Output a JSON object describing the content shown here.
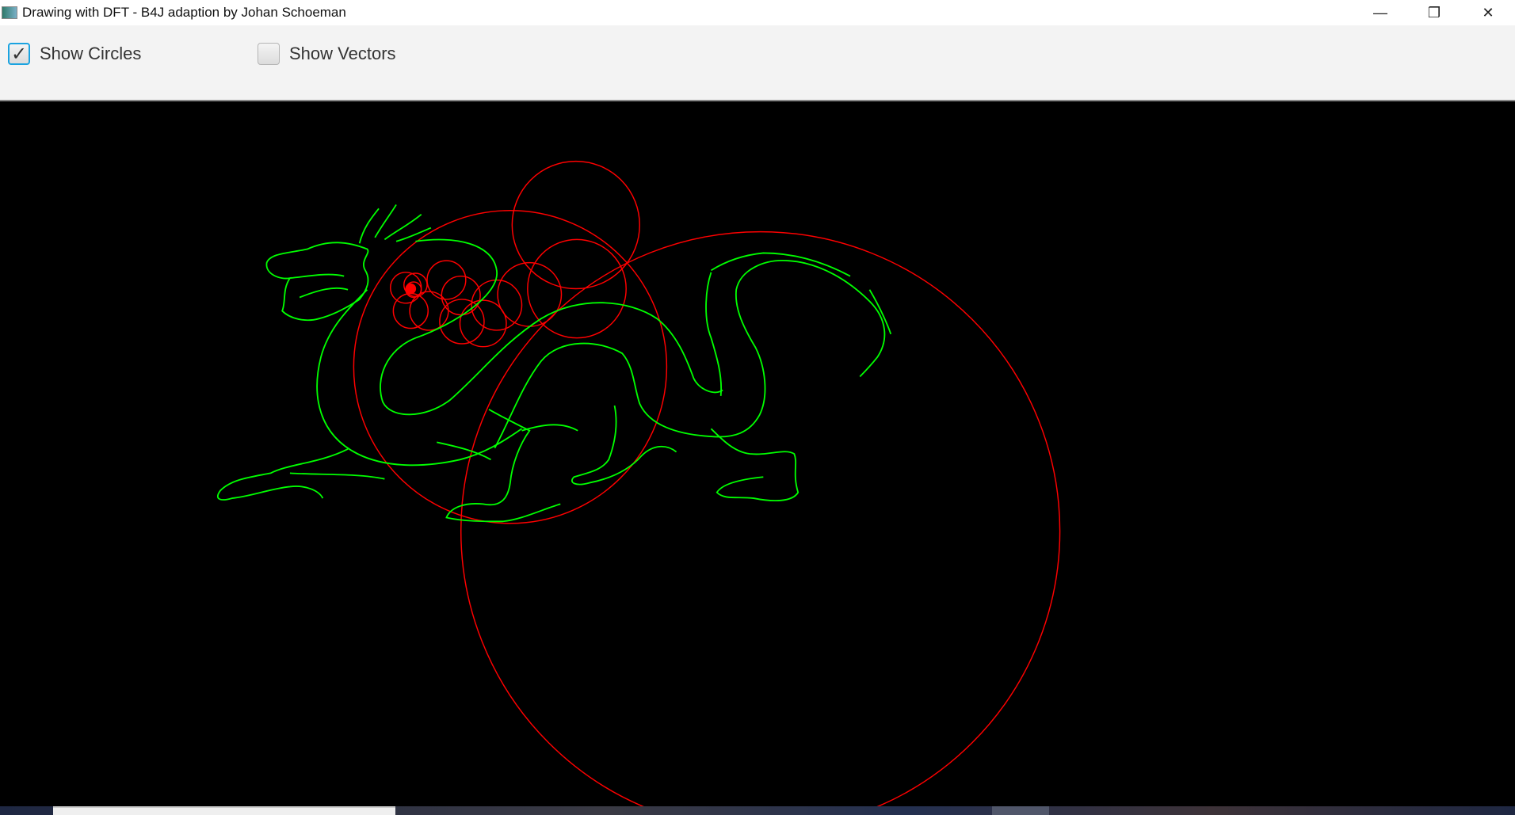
{
  "window": {
    "title": "Drawing with DFT - B4J adaption by Johan Schoeman",
    "minimize_icon": "minimize-icon",
    "restore_icon": "restore-icon",
    "close_icon": "close-icon"
  },
  "toolbar": {
    "show_circles": {
      "label": "Show Circles",
      "checked": true
    },
    "show_vectors": {
      "label": "Show Vectors",
      "checked": false
    }
  },
  "canvas": {
    "background": "#000000",
    "circle_color": "#ff0000",
    "drawing_color": "#00ff00"
  }
}
